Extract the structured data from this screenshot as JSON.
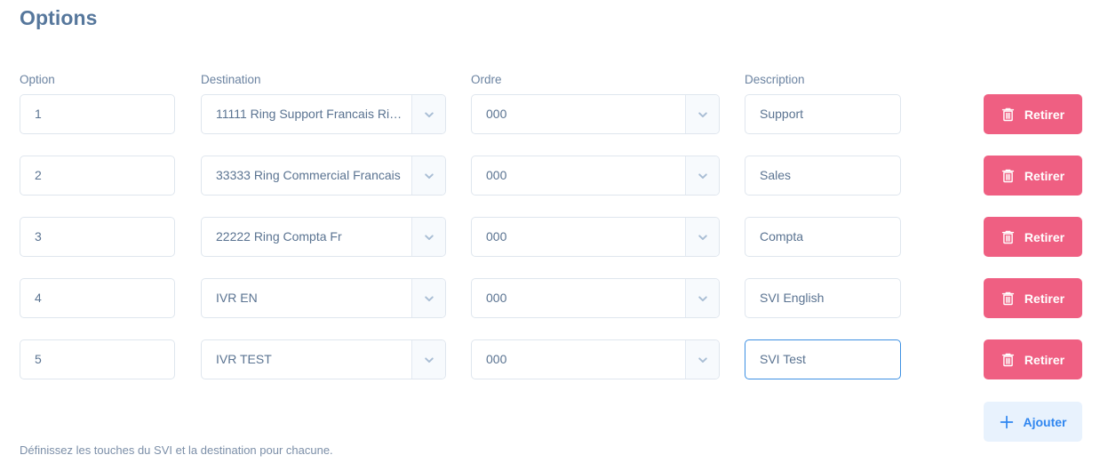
{
  "page": {
    "title": "Options",
    "hint": "Définissez les touches du SVI et la destination pour chacune."
  },
  "columns": {
    "option": "Option",
    "destination": "Destination",
    "ordre": "Ordre",
    "description": "Description"
  },
  "actions": {
    "remove_label": "Retirer",
    "remove_icon": "trash-icon",
    "add_label": "Ajouter",
    "add_icon": "plus-icon",
    "dropdown_icon": "chevron-down-icon"
  },
  "colors": {
    "title": "#56779c",
    "label": "#6b83a1",
    "field_text": "#5a7391",
    "field_border": "#dfe6ee",
    "field_border_focused": "#3d90e3",
    "remove_button_bg": "#ef5f82",
    "remove_button_text": "#ffffff",
    "add_button_bg": "#e8f2fd",
    "add_button_text": "#2f86f0",
    "dropdown_arrow_bg": "#f7fafd"
  },
  "rows": [
    {
      "option": "1",
      "destination": "11111 Ring Support Francais Rin...",
      "ordre": "000",
      "description": "Support",
      "description_focused": false
    },
    {
      "option": "2",
      "destination": "33333 Ring Commercial Francais",
      "ordre": "000",
      "description": "Sales",
      "description_focused": false
    },
    {
      "option": "3",
      "destination": "22222 Ring Compta Fr",
      "ordre": "000",
      "description": "Compta",
      "description_focused": false
    },
    {
      "option": "4",
      "destination": "IVR EN",
      "ordre": "000",
      "description": "SVI English",
      "description_focused": false
    },
    {
      "option": "5",
      "destination": "IVR TEST",
      "ordre": "000",
      "description": "SVI Test",
      "description_focused": true
    }
  ]
}
